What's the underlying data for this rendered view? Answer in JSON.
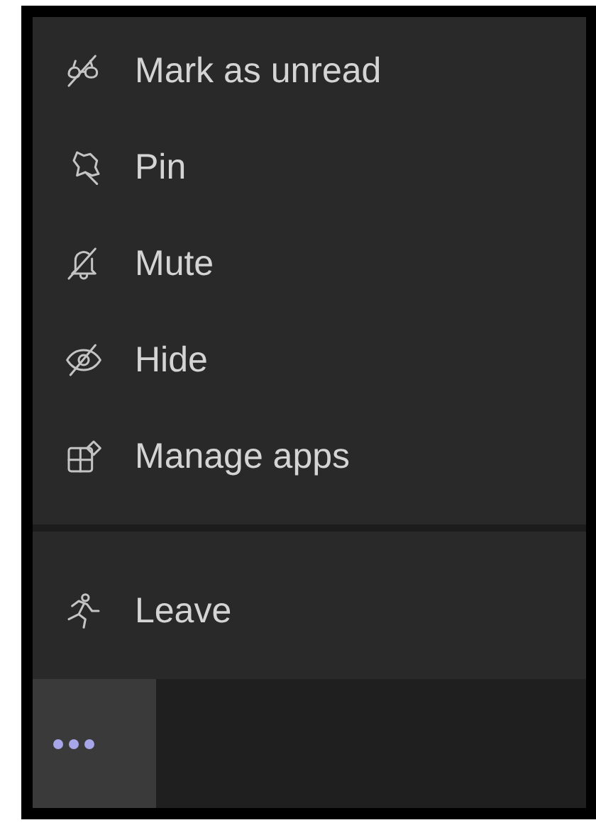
{
  "menu": {
    "groups": [
      {
        "items": [
          {
            "label": "Mark as unread"
          },
          {
            "label": "Pin"
          },
          {
            "label": "Mute"
          },
          {
            "label": "Hide"
          },
          {
            "label": "Manage apps"
          }
        ]
      },
      {
        "items": [
          {
            "label": "Leave"
          }
        ]
      }
    ]
  },
  "toolbar": {
    "more_button": {
      "selected": true
    }
  }
}
